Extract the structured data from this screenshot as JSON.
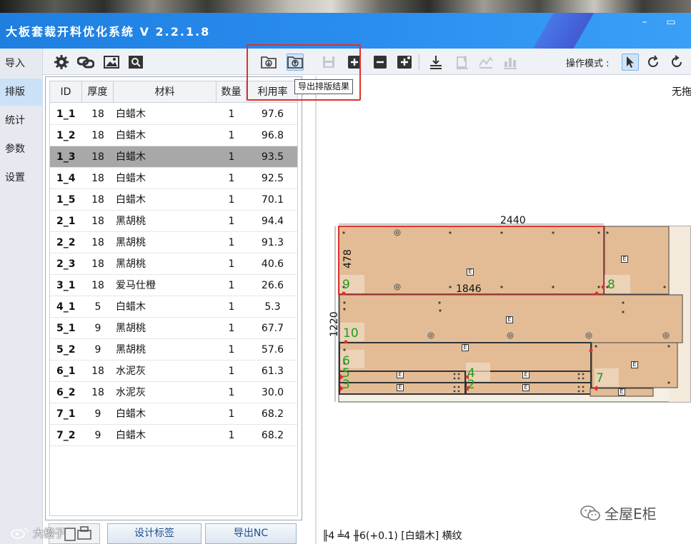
{
  "window": {
    "title": "大板套裁开料优化系统 V 2.2.1.8",
    "minimize_symbol": "–",
    "maximize_symbol": "▭"
  },
  "nav": {
    "items": [
      {
        "label": "导入"
      },
      {
        "label": "排版",
        "active": true
      },
      {
        "label": "统计"
      },
      {
        "label": "参数"
      },
      {
        "label": "设置"
      }
    ]
  },
  "toolbar": {
    "icons": [
      "gear-icon",
      "link-chain-icon",
      "image-icon",
      "search-image-icon",
      "import-layout-icon",
      "export-layout-icon",
      "save-icon",
      "add-icon",
      "remove-icon",
      "add-plus-icon",
      "download-icon",
      "cut-tool-icon",
      "chart-icon",
      "bar-chart-icon"
    ],
    "operation_mode_label": "操作模式 :",
    "tooltip": "导出排版结果",
    "mode_icons": [
      "pointer-icon",
      "rotate-icon",
      "refresh-icon"
    ]
  },
  "list": {
    "columns": [
      "ID",
      "厚度",
      "材料",
      "数量",
      "利用率"
    ],
    "rows": [
      {
        "id": "1_1",
        "thickness": "18",
        "material": "白蜡木",
        "qty": "1",
        "rate": "97.6"
      },
      {
        "id": "1_2",
        "thickness": "18",
        "material": "白蜡木",
        "qty": "1",
        "rate": "96.8"
      },
      {
        "id": "1_3",
        "thickness": "18",
        "material": "白蜡木",
        "qty": "1",
        "rate": "93.5",
        "selected": true
      },
      {
        "id": "1_4",
        "thickness": "18",
        "material": "白蜡木",
        "qty": "1",
        "rate": "92.5"
      },
      {
        "id": "1_5",
        "thickness": "18",
        "material": "白蜡木",
        "qty": "1",
        "rate": "70.1"
      },
      {
        "id": "2_1",
        "thickness": "18",
        "material": "黑胡桃",
        "qty": "1",
        "rate": "94.4"
      },
      {
        "id": "2_2",
        "thickness": "18",
        "material": "黑胡桃",
        "qty": "1",
        "rate": "91.3"
      },
      {
        "id": "2_3",
        "thickness": "18",
        "material": "黑胡桃",
        "qty": "1",
        "rate": "40.6"
      },
      {
        "id": "3_1",
        "thickness": "18",
        "material": "爱马仕橙",
        "qty": "1",
        "rate": "26.6"
      },
      {
        "id": "4_1",
        "thickness": "5",
        "material": "白蜡木",
        "qty": "1",
        "rate": "5.3"
      },
      {
        "id": "5_1",
        "thickness": "9",
        "material": "黑胡桃",
        "qty": "1",
        "rate": "67.7"
      },
      {
        "id": "5_2",
        "thickness": "9",
        "material": "黑胡桃",
        "qty": "1",
        "rate": "57.6"
      },
      {
        "id": "6_1",
        "thickness": "18",
        "material": "水泥灰",
        "qty": "1",
        "rate": "61.3"
      },
      {
        "id": "6_2",
        "thickness": "18",
        "material": "水泥灰",
        "qty": "1",
        "rate": "30.0"
      },
      {
        "id": "7_1",
        "thickness": "9",
        "material": "白蜡木",
        "qty": "1",
        "rate": "68.2"
      },
      {
        "id": "7_2",
        "thickness": "9",
        "material": "白蜡木",
        "qty": "1",
        "rate": "68.2"
      }
    ]
  },
  "buttons": {
    "design_label": "设计标签",
    "export_nc": "导出NC"
  },
  "canvas": {
    "top_right_text": "无拖",
    "board_width_label": "2440",
    "board_height_label": "1220",
    "piece_height_label": "478",
    "piece_width_label": "1846",
    "piece_numbers": [
      "9",
      "8",
      "10",
      "6",
      "5",
      "4",
      "7",
      "3",
      "2"
    ],
    "piece_marker": "E",
    "status": "╟4 ╧4 ╫6(+0.1)  [白蜡木] 横纹"
  },
  "watermark": {
    "right": "全屋E柜",
    "left": "大橙子"
  },
  "colors": {
    "titlebar": "#2a8ef0",
    "board": "#e3bc95",
    "board_border": "#333333",
    "selected_piece": "#e0302c",
    "piece_number": "#1aa01a",
    "highlight": "#e0302c"
  }
}
